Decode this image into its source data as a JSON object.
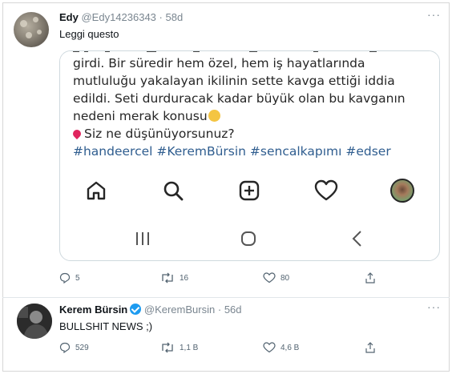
{
  "tweet1": {
    "name": "Edy",
    "handle": "@Edy14236343",
    "separator": "·",
    "time": "58d",
    "text": "Leggi questo",
    "more": "···",
    "embedded": {
      "lines": [
        "girdi. Bir süredir hem özel, hem iş hayatlarında",
        "mutluluğu yakalayan ikilinin sette kavga ettiği iddia",
        "edildi. Seti durduracak kadar büyük olan bu kavganın",
        "nedeni merak konusu"
      ],
      "question": "Siz ne düşünüyorsunuz?",
      "hashtags": "#handeercel #KeremBürsin #sencalkapımı #edser",
      "nav_icons": [
        "home-icon",
        "search-icon",
        "add-post-icon",
        "heart-icon",
        "profile-avatar"
      ],
      "system_icons": [
        "recent-apps-icon",
        "home-circle-icon",
        "back-chevron-icon"
      ]
    },
    "actions": {
      "replies": "5",
      "retweets": "16",
      "likes": "80"
    }
  },
  "tweet2": {
    "name": "Kerem Bürsin",
    "handle": "@KeremBursin",
    "separator": "·",
    "time": "56d",
    "text": "BULLSHIT NEWS ;)",
    "more": "···",
    "actions": {
      "replies": "529",
      "retweets": "1,1 B",
      "likes": "4,6 B"
    }
  },
  "colors": {
    "accent": "#1d9bf0",
    "hashtag": "#2f5d8f",
    "muted": "#536471"
  }
}
